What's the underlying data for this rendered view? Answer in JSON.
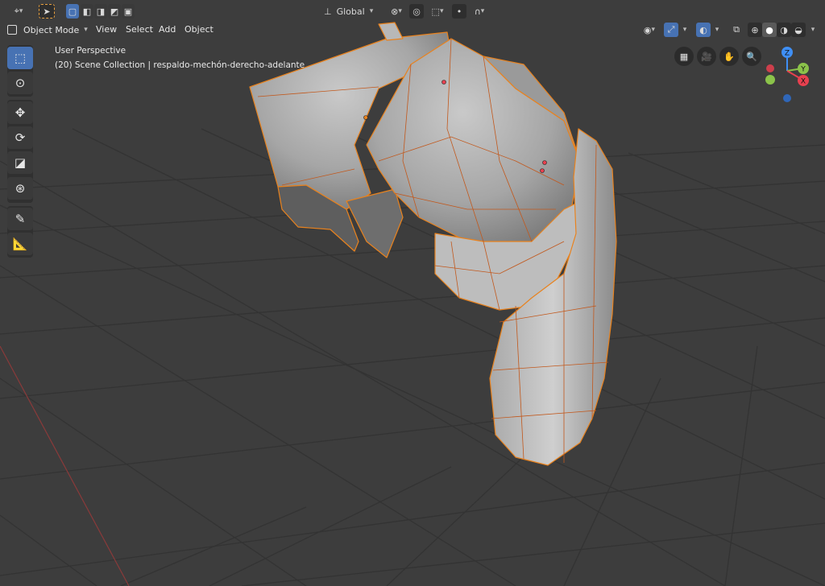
{
  "header": {
    "orientation_label": "Global",
    "mode_label": "Object Mode",
    "menus": [
      "View",
      "Select",
      "Add",
      "Object"
    ]
  },
  "overlay": {
    "perspective": "User Perspective",
    "collection": "(20) Scene Collection | respaldo-mechón-derecho-adelante"
  },
  "gizmo": {
    "z": "Z",
    "y": "Y",
    "x": "X"
  },
  "icons": {
    "editor_type": "editor-type-icon",
    "select_box": "select-box-icon",
    "move": "move-icon",
    "rotate": "rotate-icon",
    "scale": "scale-icon",
    "transform": "transform-icon",
    "annotate": "annotate-icon",
    "measure": "measure-icon",
    "cursor": "cursor-icon"
  },
  "colors": {
    "accent": "#4772b3",
    "selection_outline": "#e8821e",
    "axis_x": "#e8404f",
    "axis_y": "#8bc34a",
    "axis_z": "#3f8ff5"
  }
}
